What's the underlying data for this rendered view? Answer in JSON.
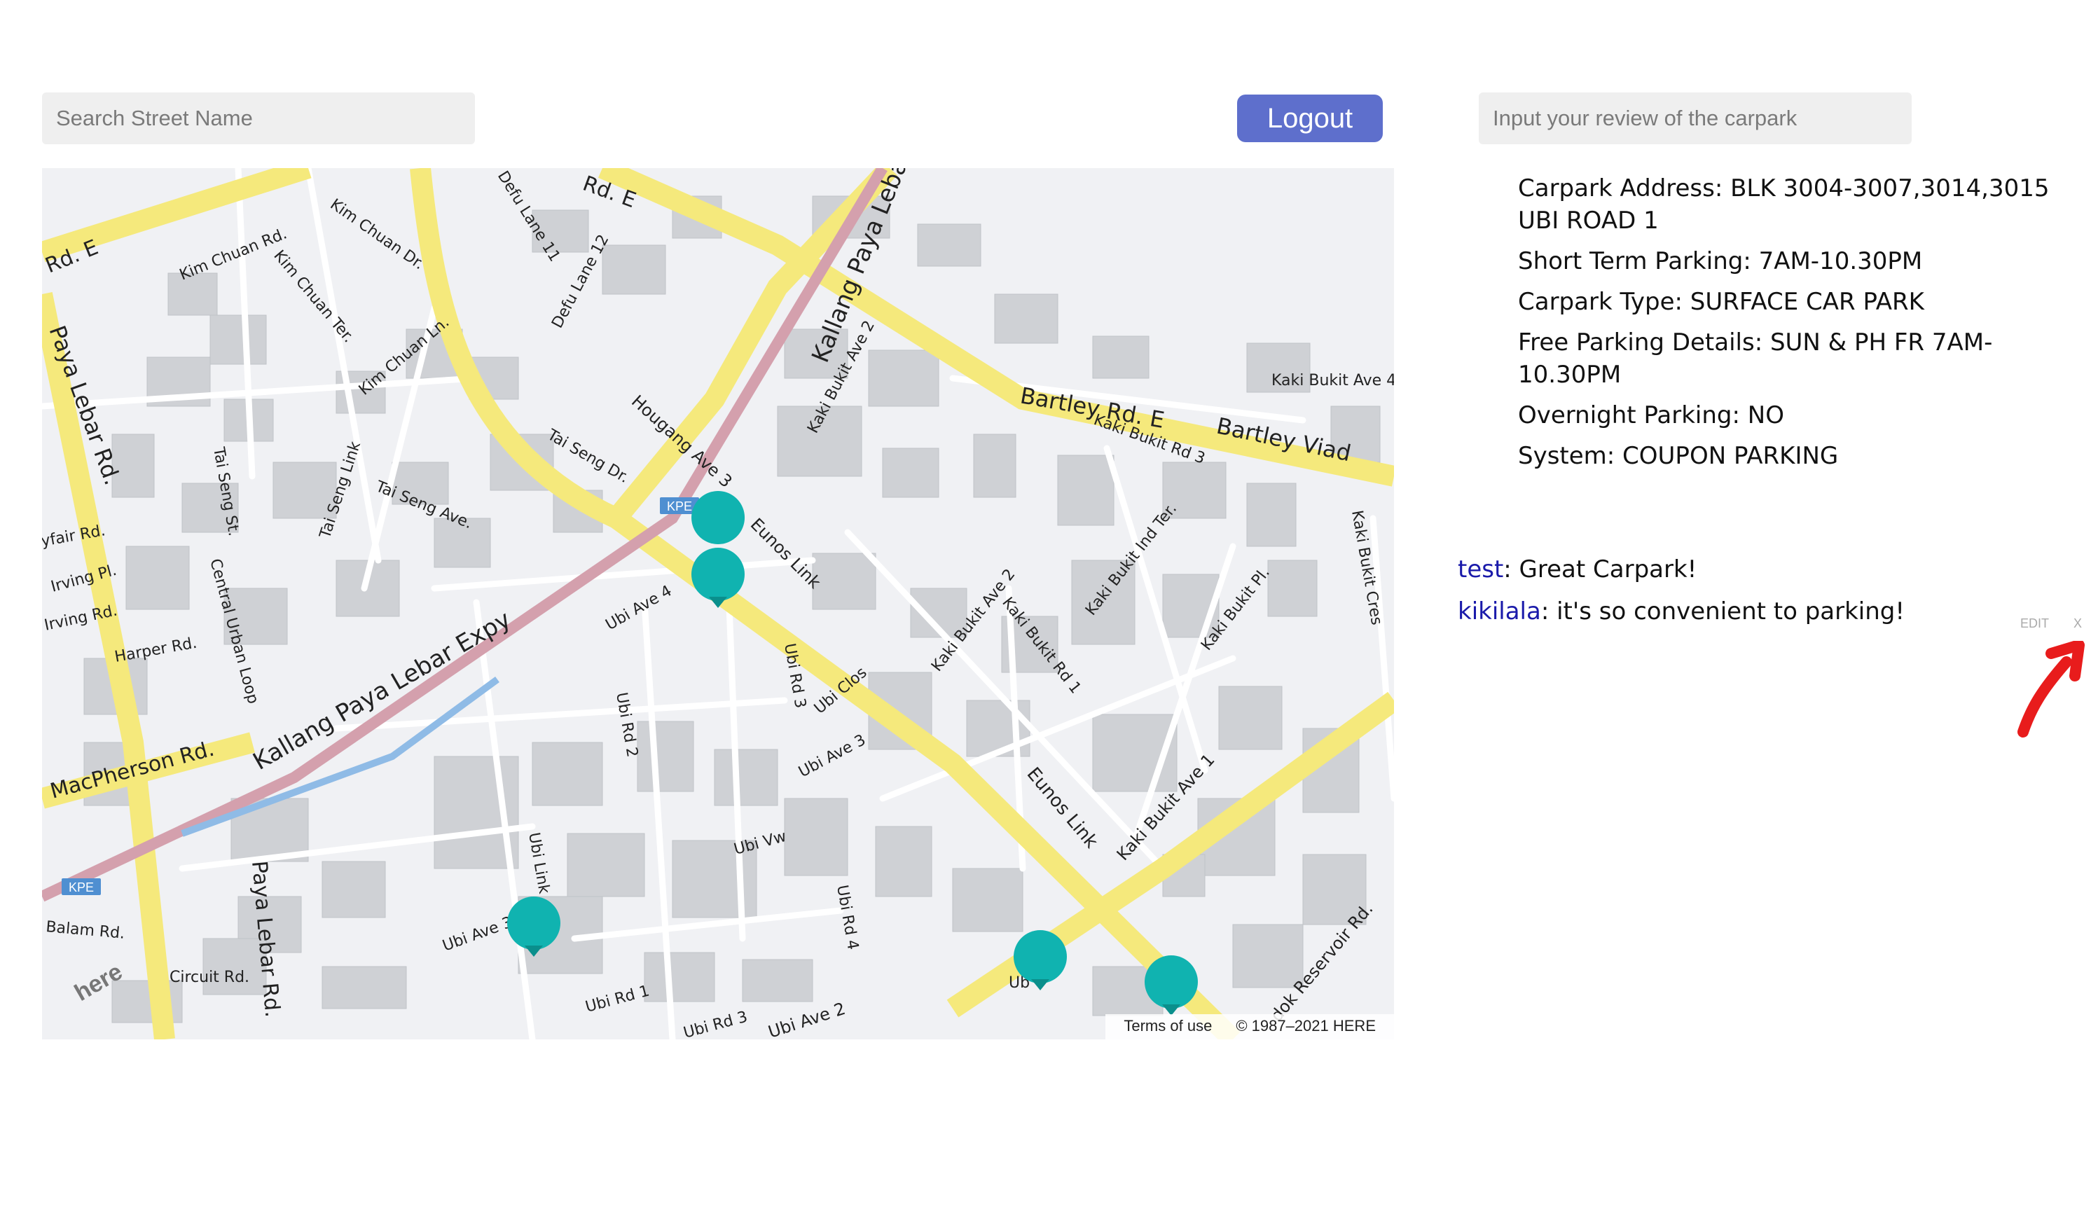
{
  "search": {
    "placeholder": "Search Street Name"
  },
  "logout_label": "Logout",
  "review_input": {
    "placeholder": "Input your review of the carpark"
  },
  "carpark": {
    "address": "Carpark Address: BLK 3004-3007,3014,3015 UBI ROAD 1",
    "short_term": "Short Term Parking: 7AM-10.30PM",
    "type": "Carpark Type: SURFACE CAR PARK",
    "free_parking": "Free Parking Details: SUN & PH FR 7AM-10.30PM",
    "overnight": "Overnight Parking: NO",
    "system": "System: COUPON PARKING"
  },
  "reviews": [
    {
      "user": "test",
      "text": ": Great Carpark!"
    },
    {
      "user": "kikilala",
      "text": ": it's so convenient to parking!"
    }
  ],
  "review_actions": {
    "edit": "EDIT",
    "delete": "X"
  },
  "map": {
    "attribution_terms": "Terms of use",
    "attribution_copyright": "© 1987–2021 HERE",
    "logo_text": "here",
    "expressway_badge": "KPE",
    "labels": {
      "rd_e_top": "Rd. E",
      "rd_e_left": "Rd. E",
      "kim_chuan_dr": "Kim Chuan Dr.",
      "kim_chuan_rd": "Kim Chuan Rd.",
      "kim_chuan_ter": "Kim Chuan Ter.",
      "kim_chuan_ln": "Kim Chuan Ln.",
      "defu_lane_11": "Defu Lane 11",
      "defu_lane_12": "Defu Lane 12",
      "kallang_paya_lebar_top": "Kallang Paya Leba",
      "kaki_bukit_ave2_top": "Kaki Bukit Ave 2",
      "bartley_rd_e": "Bartley Rd. E",
      "bartley_viad": "Bartley Viad",
      "kaki_bukit_rd3": "Kaki Bukit Rd 3",
      "kaki_bukit_ave4": "Kaki Bukit Ave 4",
      "paya_lebar_rd_top": "Paya Lebar Rd.",
      "tai_seng_st": "Tai Seng St.",
      "tai_seng_link": "Tai Seng Link",
      "tai_seng_dr": "Tai Seng Dr.",
      "tai_seng_ave": "Tai Seng Ave.",
      "hougang_ave3": "Hougang Ave 3",
      "eunos_link_top": "Eunos Link",
      "yfair_rd": "yfair Rd.",
      "irving_pl": "Irving Pl.",
      "irving_rd": "Irving Rd.",
      "harper_rd": "Harper Rd.",
      "central_urban_loop": "Central Urban Loop",
      "kallang_paya_lebar_expy": "Kallang Paya Lebar Expy",
      "ubi_ave4": "Ubi Ave 4",
      "ubi_rd3": "Ubi Rd 3",
      "ubi_clos": "Ubi Clos",
      "ubi_ave3_mid": "Ubi Ave 3",
      "ubi_rd2": "Ubi Rd 2",
      "kaki_bukit_ave2": "Kaki Bukit Ave 2",
      "kaki_bukit_rd1": "Kaki Bukit Rd 1",
      "kaki_bukit_ind_ter": "Kaki Bukit Ind Ter.",
      "kaki_bukit_pl": "Kaki Bukit Pl.",
      "kaki_bukit_cres": "Kaki Bukit Cres",
      "macpherson_rd": "MacPherson Rd.",
      "eunos_link_bottom": "Eunos Link",
      "kaki_bukit_ave1": "Kaki Bukit Ave 1",
      "ubi_link": "Ubi Link",
      "ubi_vw": "Ubi Vw",
      "ubi_rd4": "Ubi Rd 4",
      "paya_lebar_rd_bottom": "Paya Lebar Rd.",
      "balam_rd": "Balam Rd.",
      "circuit_rd": "Circuit Rd.",
      "ubi_ave3_bottom": "Ubi Ave 3",
      "ubi_rd1": "Ubi Rd 1",
      "ubi_rd3_bottom": "Ubi Rd 3",
      "ubi_ave2": "Ubi Ave 2",
      "ubi_short": "Ub",
      "reservoir_rd": "dok Reservoir Rd."
    }
  },
  "colors": {
    "marker": "#10b3b0",
    "logout_bg": "#5e6fcc",
    "road_major": "#f5e97c",
    "expressway": "#d4a0ad",
    "map_bg": "#f0f1f4",
    "building": "#cfd1d5",
    "arrow": "#e81c1c",
    "username": "#1a1aaa"
  }
}
